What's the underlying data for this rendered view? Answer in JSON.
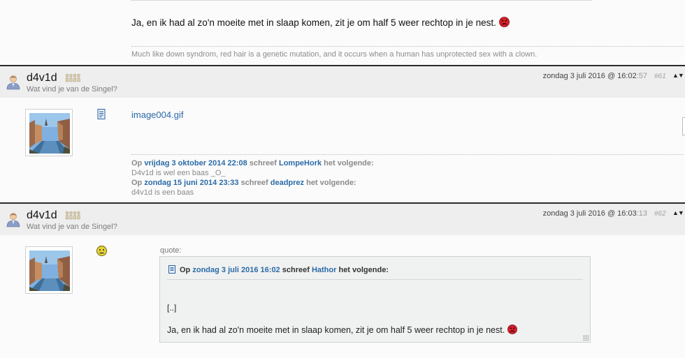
{
  "previous_post": {
    "message": "Ja, en ik had al zo'n moeite met in slaap komen, zit je om half 5 weer rechtop in je nest.",
    "signature": "Much like down syndrom, red hair is a genetic mutation, and it occurs when a human has unprotected sex with a clown."
  },
  "posts": [
    {
      "username": "d4v1d",
      "usertitle": "Wat vind je van de Singel?",
      "date_main": "zondag 3 juli 2016 @ 16:02",
      "date_seconds": ":57",
      "post_number": "#61",
      "sort_icon": "up-down-arrows",
      "message_icon": "document-icon",
      "attachment": "image004.gif",
      "signature_quotes": [
        {
          "prefix": "Op",
          "date": "vrijdag 3 oktober 2014 22:08",
          "mid": "schreef",
          "author": "LompeHork",
          "suffix": "het volgende:",
          "text": "D4v1d is wel een baas _O_"
        },
        {
          "prefix": "Op",
          "date": "zondag 15 juni 2014 23:33",
          "mid": "schreef",
          "author": "deadprez",
          "suffix": "het volgende:",
          "text": "d4v1d is een baas"
        }
      ]
    },
    {
      "username": "d4v1d",
      "usertitle": "Wat vind je van de Singel?",
      "date_main": "zondag 3 juli 2016 @ 16:03",
      "date_seconds": ":13",
      "post_number": "#62",
      "sort_icon": "up-down-arrows",
      "message_icon": "worried-smiley-icon",
      "quote": {
        "label": "quote:",
        "prefix": "Op",
        "date": "zondag 3 juli 2016 16:02",
        "mid": "schreef",
        "author": "Hathor",
        "suffix": "het volgende:",
        "ellipsis": "[..]",
        "text": "Ja, en ik had al zo'n moeite met in slaap komen, zit je om half 5 weer rechtop in je nest."
      }
    }
  ],
  "colors": {
    "link": "#2a6ba8",
    "header_bg": "#eeeeee",
    "header_border": "#2b2b2b",
    "muted_text": "#8a8a8a",
    "angry_smiley": "#d4202a"
  }
}
